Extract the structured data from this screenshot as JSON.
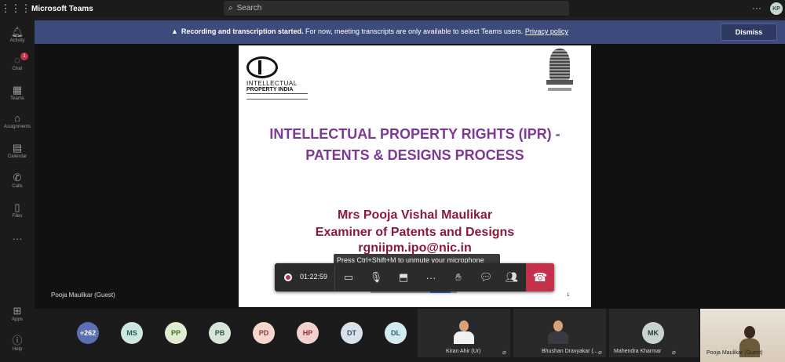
{
  "app": {
    "title": "Microsoft Teams",
    "search_placeholder": "Search",
    "user_initials": "KP"
  },
  "rail": [
    {
      "label": "Activity"
    },
    {
      "label": "Chat",
      "badge": "1"
    },
    {
      "label": "Teams"
    },
    {
      "label": "Assignments"
    },
    {
      "label": "Calendar"
    },
    {
      "label": "Calls"
    },
    {
      "label": "Files"
    },
    {
      "label": "Apps"
    },
    {
      "label": "Help"
    }
  ],
  "banner": {
    "bold": "Recording and transcription started.",
    "text": " For now, meeting transcripts are only available to select Teams users. ",
    "link": "Privacy policy",
    "dismiss": "Dismiss"
  },
  "slide": {
    "logo_line1": "INTELLECTUAL",
    "logo_line2": "PROPERTY INDIA",
    "title_line1": "INTELLECTUAL PROPERTY RIGHTS (IPR) -",
    "title_line2": "PATENTS & DESIGNS PROCESS",
    "presenter_name": "Mrs Pooja Vishal Maulikar",
    "presenter_role": "Examiner of Patents and Designs",
    "email": "rgniipm.ipo@nic.in",
    "page_number": "1"
  },
  "tooltip": "Press Ctrl+Shift+M to unmute your microphone",
  "callbar": {
    "timer": "01:22:59"
  },
  "presenter_label": "Pooja Maulikar (Guest)",
  "participants": {
    "overflow_count": "+262",
    "avatars": [
      {
        "initials": "MS",
        "bg": "#cde6e1",
        "fg": "#2b5f58"
      },
      {
        "initials": "PP",
        "bg": "#e0ecd2",
        "fg": "#4b6a2b"
      },
      {
        "initials": "PB",
        "bg": "#d6e6da",
        "fg": "#2f5a3c"
      },
      {
        "initials": "PD",
        "bg": "#f6d7cf",
        "fg": "#8a3a2a"
      },
      {
        "initials": "HP",
        "bg": "#f3d1cf",
        "fg": "#8f2f34"
      },
      {
        "initials": "DT",
        "bg": "#d9e2ea",
        "fg": "#38506a"
      },
      {
        "initials": "DL",
        "bg": "#d4eaf1",
        "fg": "#2d5f72"
      }
    ],
    "tiles": [
      {
        "name": "Kiran Ahir (Ur)"
      },
      {
        "name": "Bhushan Dravyakar (..."
      },
      {
        "name": "Mahendra Kharmar",
        "initials": "MK"
      }
    ],
    "guest": {
      "name": "Pooja Maulikar (Guest)"
    }
  }
}
